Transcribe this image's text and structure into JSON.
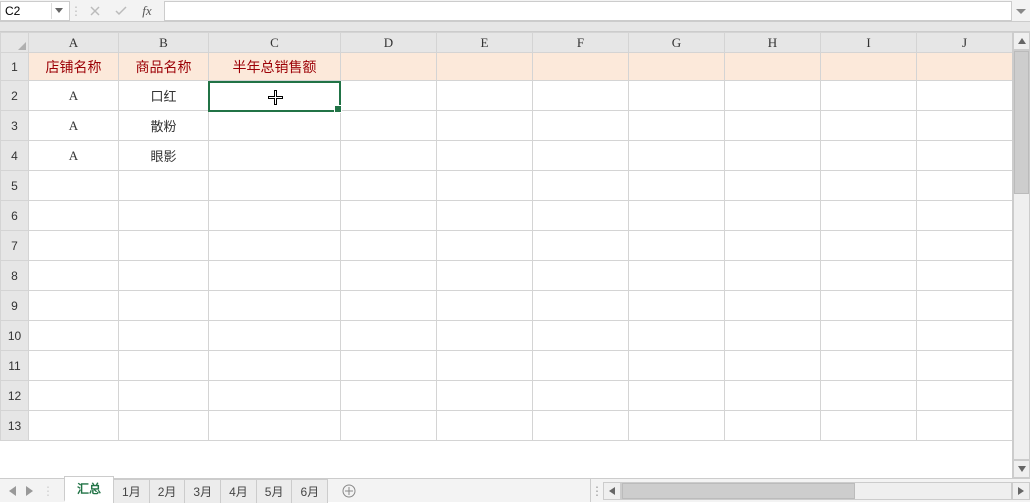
{
  "name_box": {
    "value": "C2"
  },
  "formula_bar": {
    "value": "",
    "fx_label": "fx"
  },
  "columns": [
    "A",
    "B",
    "C",
    "D",
    "E",
    "F",
    "G",
    "H",
    "I",
    "J"
  ],
  "row_numbers": [
    "1",
    "2",
    "3",
    "4",
    "5",
    "6",
    "7",
    "8",
    "9",
    "10",
    "11",
    "12",
    "13"
  ],
  "header_row": {
    "A": "店铺名称",
    "B": "商品名称",
    "C": "半年总销售额"
  },
  "data_rows": [
    {
      "A": "A",
      "B": "口红",
      "C": ""
    },
    {
      "A": "A",
      "B": "散粉",
      "C": ""
    },
    {
      "A": "A",
      "B": "眼影",
      "C": ""
    }
  ],
  "active_cell": "C2",
  "sheet_tabs": {
    "active": "汇总",
    "tabs": [
      "汇总",
      "1月",
      "2月",
      "3月",
      "4月",
      "5月",
      "6月"
    ]
  }
}
